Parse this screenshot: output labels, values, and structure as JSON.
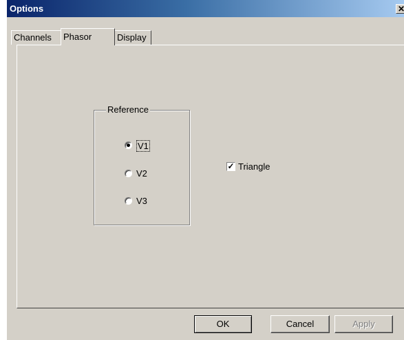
{
  "window": {
    "title": "Options",
    "close_glyph": "✕"
  },
  "tabs": [
    {
      "label": "Channels",
      "active": false
    },
    {
      "label": "Phasor",
      "active": true
    },
    {
      "label": "Display",
      "active": false
    }
  ],
  "phasor": {
    "reference_group": {
      "label": "Reference",
      "options": [
        {
          "label": "V1",
          "checked": true
        },
        {
          "label": "V2",
          "checked": false
        },
        {
          "label": "V3",
          "checked": false
        }
      ]
    },
    "triangle": {
      "label": "Triangle",
      "checked": true,
      "check_glyph": "✓"
    }
  },
  "buttons": {
    "ok": "OK",
    "cancel": "Cancel",
    "apply": "Apply"
  }
}
